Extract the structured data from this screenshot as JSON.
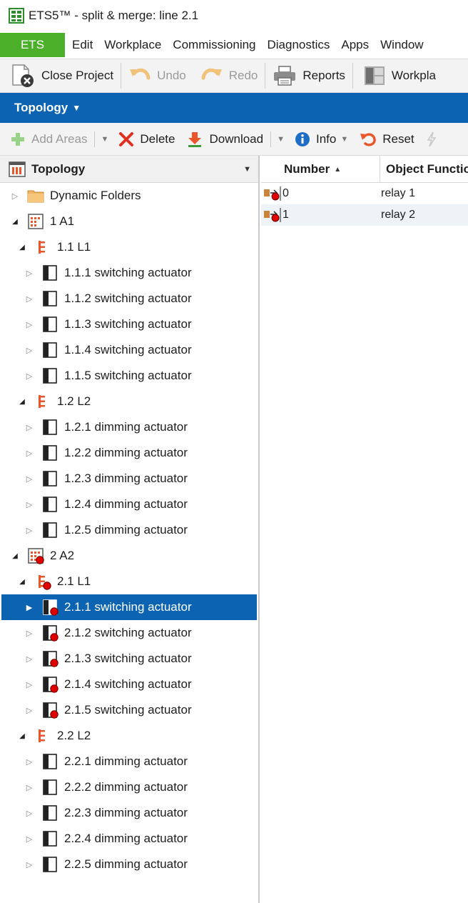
{
  "window": {
    "title": "ETS5™ - split & merge: line 2.1"
  },
  "menu": {
    "ets_label": "ETS",
    "items": [
      "Edit",
      "Workplace",
      "Commissioning",
      "Diagnostics",
      "Apps",
      "Window"
    ]
  },
  "toolbar": {
    "close_project": "Close Project",
    "undo": "Undo",
    "redo": "Redo",
    "reports": "Reports",
    "workplace": "Workpla"
  },
  "panel": {
    "title": "Topology"
  },
  "subtoolbar": {
    "add_areas": "Add Areas",
    "delete": "Delete",
    "download": "Download",
    "info": "Info",
    "reset": "Reset"
  },
  "tree": {
    "header": "Topology",
    "nodes": [
      {
        "label": "Dynamic Folders",
        "level": 0,
        "expander": "collapsed",
        "icon": "folder-icon",
        "error": false,
        "selected": false
      },
      {
        "label": "1 A1",
        "level": 0,
        "expander": "expanded",
        "icon": "area-icon",
        "error": false,
        "selected": false
      },
      {
        "label": "1.1 L1",
        "level": 1,
        "expander": "expanded",
        "icon": "line-icon",
        "error": false,
        "selected": false
      },
      {
        "label": "1.1.1 switching actuator",
        "level": 2,
        "expander": "collapsed",
        "icon": "device-icon",
        "error": false,
        "selected": false
      },
      {
        "label": "1.1.2 switching actuator",
        "level": 2,
        "expander": "collapsed",
        "icon": "device-icon",
        "error": false,
        "selected": false
      },
      {
        "label": "1.1.3 switching actuator",
        "level": 2,
        "expander": "collapsed",
        "icon": "device-icon",
        "error": false,
        "selected": false
      },
      {
        "label": "1.1.4 switching actuator",
        "level": 2,
        "expander": "collapsed",
        "icon": "device-icon",
        "error": false,
        "selected": false
      },
      {
        "label": "1.1.5 switching actuator",
        "level": 2,
        "expander": "collapsed",
        "icon": "device-icon",
        "error": false,
        "selected": false
      },
      {
        "label": "1.2 L2",
        "level": 1,
        "expander": "expanded",
        "icon": "line-icon",
        "error": false,
        "selected": false
      },
      {
        "label": "1.2.1 dimming actuator",
        "level": 2,
        "expander": "collapsed",
        "icon": "device-icon",
        "error": false,
        "selected": false
      },
      {
        "label": "1.2.2 dimming actuator",
        "level": 2,
        "expander": "collapsed",
        "icon": "device-icon",
        "error": false,
        "selected": false
      },
      {
        "label": "1.2.3 dimming actuator",
        "level": 2,
        "expander": "collapsed",
        "icon": "device-icon",
        "error": false,
        "selected": false
      },
      {
        "label": "1.2.4 dimming actuator",
        "level": 2,
        "expander": "collapsed",
        "icon": "device-icon",
        "error": false,
        "selected": false
      },
      {
        "label": "1.2.5 dimming actuator",
        "level": 2,
        "expander": "collapsed",
        "icon": "device-icon",
        "error": false,
        "selected": false
      },
      {
        "label": "2 A2",
        "level": 0,
        "expander": "expanded",
        "icon": "area-icon",
        "error": true,
        "selected": false
      },
      {
        "label": "2.1 L1",
        "level": 1,
        "expander": "expanded",
        "icon": "line-icon",
        "error": true,
        "selected": false
      },
      {
        "label": "2.1.1 switching actuator",
        "level": 2,
        "expander": "collapsed",
        "icon": "device-icon",
        "error": true,
        "selected": true
      },
      {
        "label": "2.1.2 switching actuator",
        "level": 2,
        "expander": "collapsed",
        "icon": "device-icon",
        "error": true,
        "selected": false
      },
      {
        "label": "2.1.3 switching actuator",
        "level": 2,
        "expander": "collapsed",
        "icon": "device-icon",
        "error": true,
        "selected": false
      },
      {
        "label": "2.1.4 switching actuator",
        "level": 2,
        "expander": "collapsed",
        "icon": "device-icon",
        "error": true,
        "selected": false
      },
      {
        "label": "2.1.5 switching actuator",
        "level": 2,
        "expander": "collapsed",
        "icon": "device-icon",
        "error": true,
        "selected": false
      },
      {
        "label": "2.2 L2",
        "level": 1,
        "expander": "expanded",
        "icon": "line-icon",
        "error": false,
        "selected": false
      },
      {
        "label": "2.2.1 dimming actuator",
        "level": 2,
        "expander": "collapsed",
        "icon": "device-icon",
        "error": false,
        "selected": false
      },
      {
        "label": "2.2.2 dimming actuator",
        "level": 2,
        "expander": "collapsed",
        "icon": "device-icon",
        "error": false,
        "selected": false
      },
      {
        "label": "2.2.3 dimming actuator",
        "level": 2,
        "expander": "collapsed",
        "icon": "device-icon",
        "error": false,
        "selected": false
      },
      {
        "label": "2.2.4 dimming actuator",
        "level": 2,
        "expander": "collapsed",
        "icon": "device-icon",
        "error": false,
        "selected": false
      },
      {
        "label": "2.2.5 dimming actuator",
        "level": 2,
        "expander": "collapsed",
        "icon": "device-icon",
        "error": false,
        "selected": false
      }
    ]
  },
  "table": {
    "columns": [
      "Number",
      "Object Functio"
    ],
    "rows": [
      {
        "number": "0",
        "function": "relay 1"
      },
      {
        "number": "1",
        "function": "relay 2"
      }
    ]
  },
  "colors": {
    "accent_blue": "#0b63b1",
    "ets_green": "#4caf2a",
    "error_red": "#e00000",
    "line_orange": "#e8562a"
  }
}
